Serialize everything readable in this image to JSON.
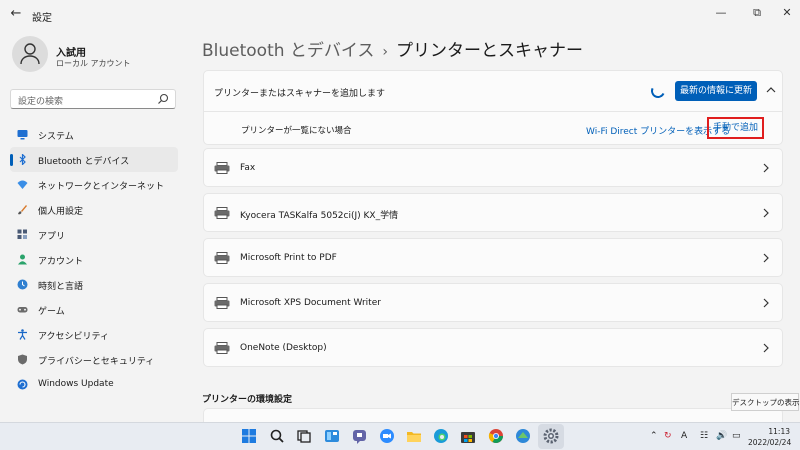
{
  "window": {
    "title": "設定"
  },
  "profile": {
    "name": "入試用",
    "account_type": "ローカル アカウント"
  },
  "search": {
    "placeholder": "設定の検索"
  },
  "nav": [
    {
      "label": "システム",
      "icon": "monitor-icon",
      "color": "#1f6fd1"
    },
    {
      "label": "Bluetooth とデバイス",
      "icon": "bluetooth-icon",
      "color": "#1f6fd1",
      "active": true
    },
    {
      "label": "ネットワークとインターネット",
      "icon": "wifi-icon",
      "color": "#3a8ee6"
    },
    {
      "label": "個人用設定",
      "icon": "brush-icon",
      "color": "#d87a2b"
    },
    {
      "label": "アプリ",
      "icon": "apps-icon",
      "color": "#4a5a75"
    },
    {
      "label": "アカウント",
      "icon": "person-icon",
      "color": "#2aa36b"
    },
    {
      "label": "時刻と言語",
      "icon": "globe-clock-icon",
      "color": "#2f7fd0"
    },
    {
      "label": "ゲーム",
      "icon": "gamepad-icon",
      "color": "#6b6b6b"
    },
    {
      "label": "アクセシビリティ",
      "icon": "accessibility-icon",
      "color": "#1a68c7"
    },
    {
      "label": "プライバシーとセキュリティ",
      "icon": "shield-icon",
      "color": "#6b6b6b"
    },
    {
      "label": "Windows Update",
      "icon": "update-icon",
      "color": "#1f6fd1"
    }
  ],
  "breadcrumb": {
    "parent": "Bluetooth とデバイス",
    "current": "プリンターとスキャナー"
  },
  "add_device": {
    "label": "プリンターまたはスキャナーを追加します",
    "refresh_button": "最新の情報に更新",
    "not_listed": "プリンターが一覧にない場合",
    "wifi_direct_link": "Wi-Fi Direct プリンターを表示する",
    "manual_add": "手動で追加"
  },
  "printers": [
    {
      "name": "Fax"
    },
    {
      "name": "Kyocera TASKalfa 5052ci(J) KX_学情"
    },
    {
      "name": "Microsoft Print to PDF"
    },
    {
      "name": "Microsoft XPS Document Writer"
    },
    {
      "name": "OneNote (Desktop)"
    }
  ],
  "section_title": "プリンターの環境設定",
  "tooltip": "デスクトップの表示",
  "taskbar": {
    "apps": [
      "windows-start-icon",
      "search-icon",
      "task-view-icon",
      "widgets-icon",
      "teams-chat-icon",
      "zoom-icon",
      "file-explorer-icon",
      "edge-icon",
      "store-icon",
      "chrome-icon",
      "control-icon",
      "settings-icon"
    ],
    "clock_time": "11:13",
    "clock_date": "2022/02/24",
    "ime": "A"
  },
  "colors": {
    "accent": "#005fb8",
    "highlight_box": "#e01e1e"
  }
}
